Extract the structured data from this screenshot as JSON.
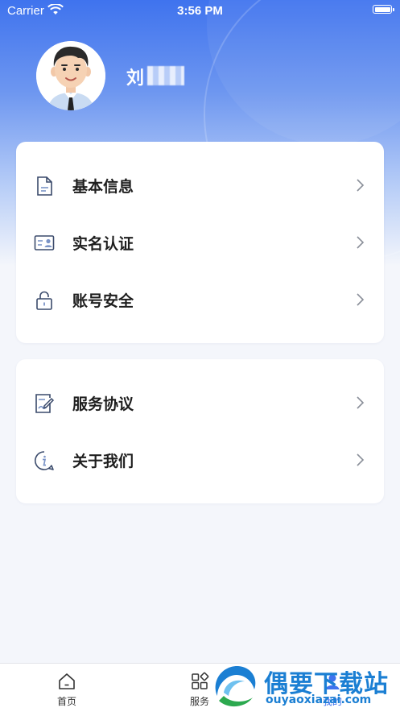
{
  "status_bar": {
    "carrier": "Carrier",
    "time": "3:56 PM"
  },
  "profile": {
    "name": "刘"
  },
  "menu_group_1": [
    {
      "label": "基本信息",
      "icon": "document-icon"
    },
    {
      "label": "实名认证",
      "icon": "id-card-icon"
    },
    {
      "label": "账号安全",
      "icon": "lock-icon"
    }
  ],
  "menu_group_2": [
    {
      "label": "服务协议",
      "icon": "agreement-icon"
    },
    {
      "label": "关于我们",
      "icon": "info-icon"
    }
  ],
  "tab_bar": {
    "home": "首页",
    "service": "服务",
    "mine": "我的"
  },
  "watermark": {
    "title": "偶要下载站",
    "url": "ouyaoxiazai.com"
  },
  "colors": {
    "accent": "#3f73ee",
    "icon": "#3a4a6b",
    "watermark": "#1b7fd3"
  }
}
